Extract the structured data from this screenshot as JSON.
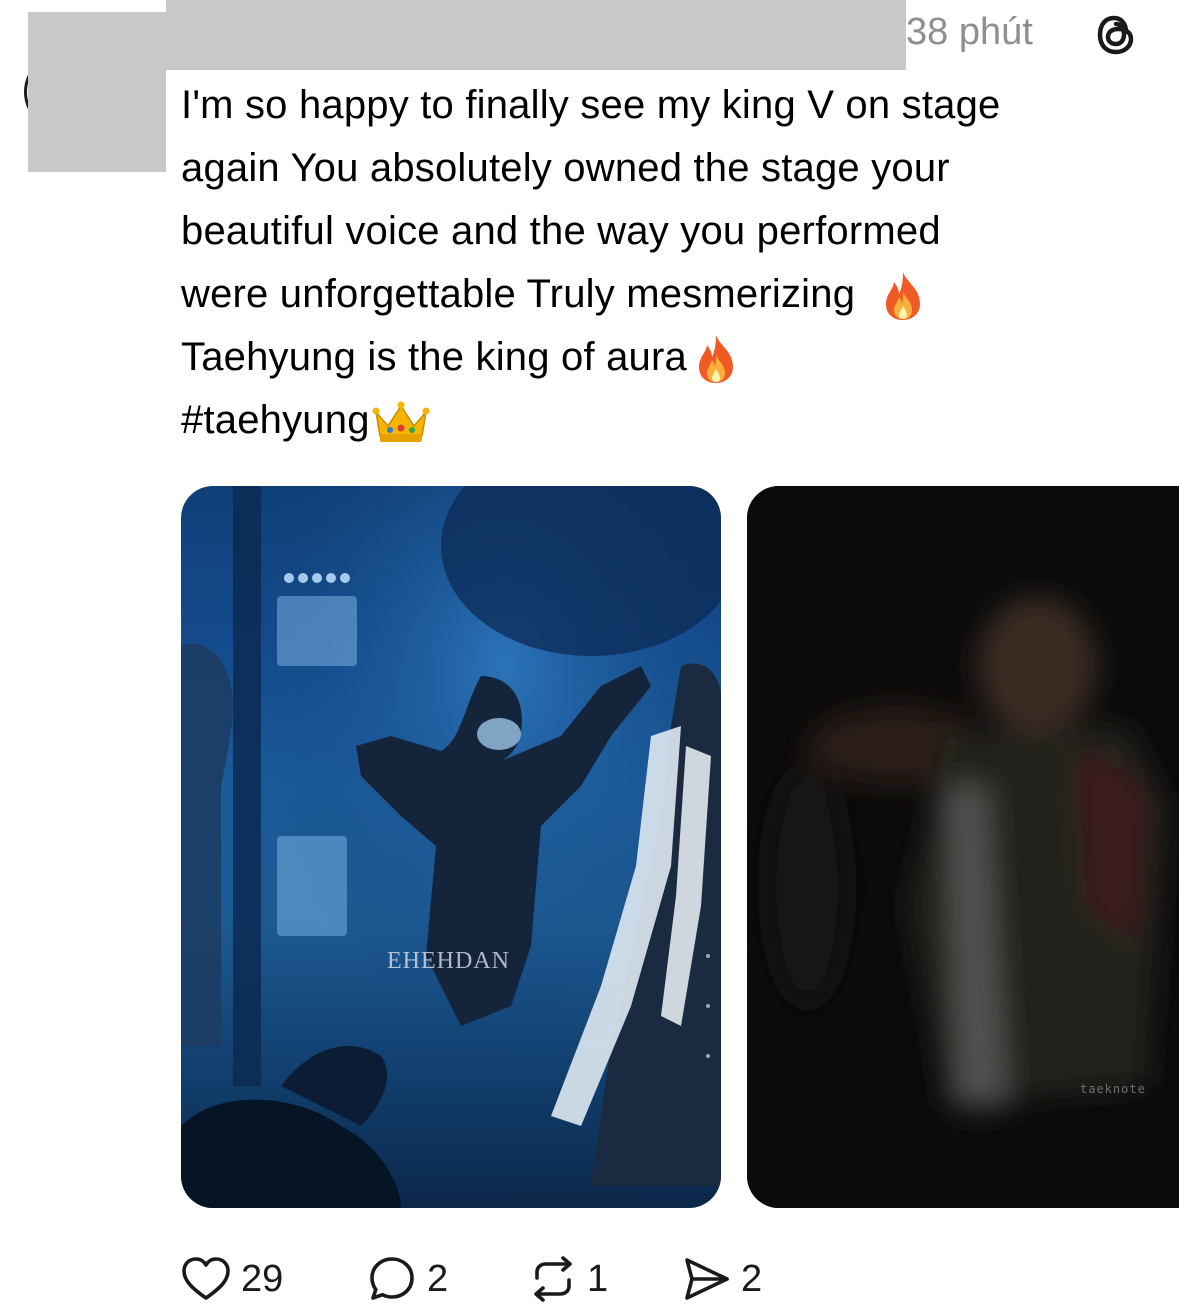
{
  "post": {
    "timestamp": "38 phút",
    "text_lines": [
      "I'm so happy to finally see my king V on stage",
      "again You absolutely owned the stage your",
      "beautiful voice and the way you performed",
      "were unforgettable Truly mesmerizing",
      "Taehyung is the king of aura",
      "#taehyung"
    ],
    "emojis": {
      "line4": "fire-emoji",
      "line5": "fire-emoji",
      "line6": "crown-emoji"
    },
    "media": [
      {
        "watermark": "EHEHDAN"
      },
      {
        "watermark": "taeknote"
      }
    ]
  },
  "actions": {
    "likes": "29",
    "replies": "2",
    "reposts": "1",
    "shares": "2"
  },
  "colors": {
    "timestamp": "#8e8e93",
    "text": "#000000",
    "redaction": "#c8c8c8"
  }
}
